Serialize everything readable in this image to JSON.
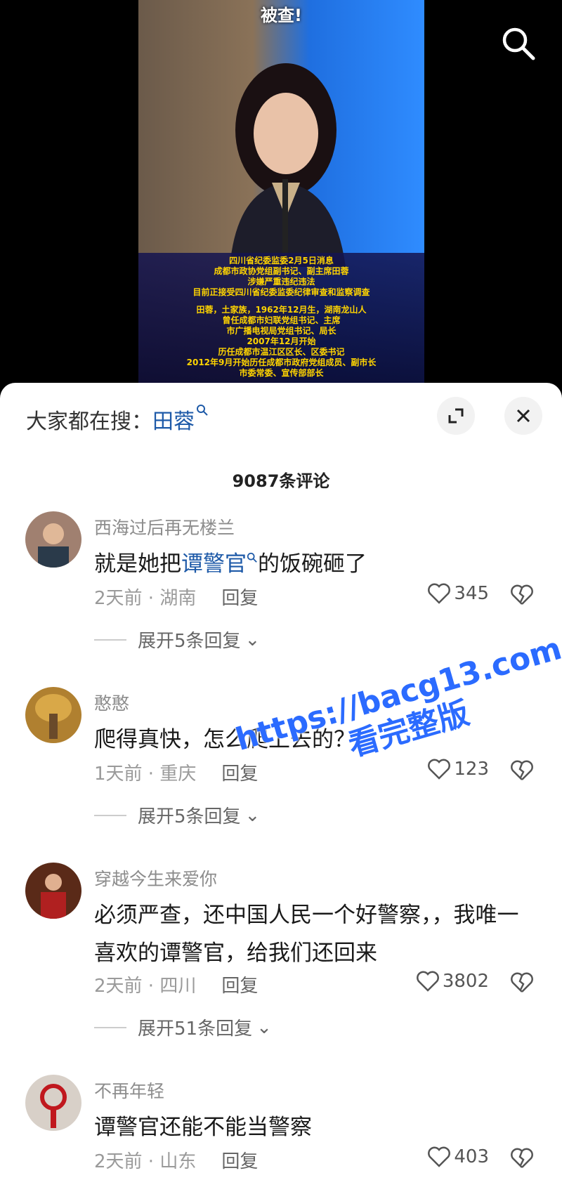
{
  "video": {
    "headline": "被查!",
    "caption_lines": [
      "四川省纪委监委2月5日消息",
      "成都市政协党组副书记、副主席田蓉",
      "涉嫌严重违纪违法",
      "目前正接受四川省纪委监委纪律审查和监察调查",
      "",
      "田蓉，土家族，1962年12月生，湖南龙山人",
      "曾任成都市妇联党组书记、主席",
      "市广播电视局党组书记、局长",
      "2007年12月开始",
      "历任成都市温江区区长、区委书记",
      "2012年9月开始历任成都市政府党组成员、副市长",
      "市委常委、宣传部部长"
    ]
  },
  "sheet": {
    "hot_search_prefix": "大家都在搜：",
    "hot_search_keyword": "田蓉",
    "comment_count": "9087条评论"
  },
  "comments": [
    {
      "user": "西海过后再无楼兰",
      "text_before": "就是她把",
      "keyword": "谭警官",
      "text_after": "的饭碗砸了",
      "time_loc": "2天前 · 湖南",
      "reply": "回复",
      "likes": "345",
      "expand": "展开5条回复"
    },
    {
      "user": "憨憨",
      "text": "爬得真快，怎么爬上去的？",
      "time_loc": "1天前 · 重庆",
      "reply": "回复",
      "likes": "123",
      "expand": "展开5条回复"
    },
    {
      "user": "穿越今生来爱你",
      "text": "必须严查，还中国人民一个好警察，，我唯一喜欢的谭警官，给我们还回来",
      "time_loc": "2天前 · 四川",
      "reply": "回复",
      "likes": "3802",
      "expand": "展开51条回复"
    },
    {
      "user": "不再年轻",
      "text": "谭警官还能不能当警察",
      "time_loc": "2天前 · 山东",
      "reply": "回复",
      "likes": "403"
    }
  ],
  "watermark": {
    "line1": "https://bacg13.com",
    "line2": "看完整版"
  },
  "colors": {
    "keyword_blue": "#1e5aa8",
    "watermark_blue": "#2b6bff",
    "caption_yellow": "#ffd400"
  }
}
